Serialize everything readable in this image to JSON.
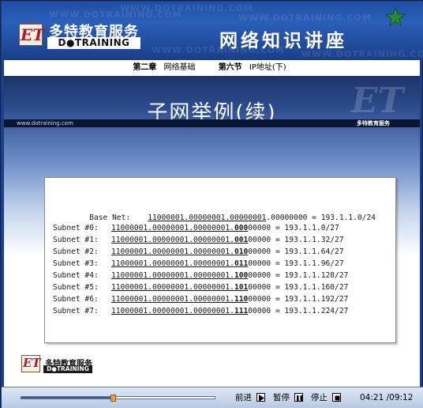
{
  "header": {
    "brand_cn": "多特教育服务",
    "brand_en": "D●TRAINING",
    "logo_letters": "ET",
    "series_title": "网络知识讲座",
    "watermark": "WWW.DOTRAINING.COM"
  },
  "chapter": {
    "chapter_label": "第二章",
    "chapter_name": "网络基础",
    "section_label": "第六节",
    "section_name": "IP地址(下)"
  },
  "slide": {
    "title": "子网举例(续)",
    "url": "www.dotraining.com",
    "brand": "多特教育服务",
    "rows": [
      {
        "label": "Base Net:",
        "net_bits": "11000001.00000001.00000001",
        "subnet_bits": "",
        "host_bits": ".00000000",
        "result": "= 193.1.1.0/24"
      },
      {
        "label": "Subnet #0:",
        "net_bits": "11000001.00000001.00000001.",
        "subnet_bits": "000",
        "host_bits": "00000",
        "result": "= 193.1.1.0/27"
      },
      {
        "label": "Subnet #1:",
        "net_bits": "11000001.00000001.00000001.",
        "subnet_bits": "001",
        "host_bits": "00000",
        "result": "= 193.1.1.32/27"
      },
      {
        "label": "Subnet #2:",
        "net_bits": "11000001.00000001.00000001.",
        "subnet_bits": "010",
        "host_bits": "00000",
        "result": "= 193.1.1.64/27"
      },
      {
        "label": "Subnet #3:",
        "net_bits": "11000001.00000001.00000001.",
        "subnet_bits": "011",
        "host_bits": "00000",
        "result": "= 193.1.1.96/27"
      },
      {
        "label": "Subnet #4:",
        "net_bits": "11000001.00000001.00000001.",
        "subnet_bits": "100",
        "host_bits": "00000",
        "result": "= 193.1.1.128/27"
      },
      {
        "label": "Subnet #5:",
        "net_bits": "11000001.00000001.00000001.",
        "subnet_bits": "101",
        "host_bits": "00000",
        "result": "= 193.1.1.160/27"
      },
      {
        "label": "Subnet #6:",
        "net_bits": "11000001.00000001.00000001.",
        "subnet_bits": "110",
        "host_bits": "00000",
        "result": "= 193.1.1.192/27"
      },
      {
        "label": "Subnet #7:",
        "net_bits": "11000001.00000001.00000001.",
        "subnet_bits": "111",
        "host_bits": "00000",
        "result": "= 193.1.1.224/27"
      }
    ],
    "footer_brand_cn": "多特教育服务",
    "footer_brand_en": "D●TRAINING",
    "footer_logo": "ET"
  },
  "controls": {
    "progress_fraction": 0.475,
    "forward_label": "前进",
    "pause_label": "暂停",
    "stop_label": "停止",
    "time_current": "04:21",
    "time_total": "/09:12"
  },
  "colors": {
    "header_blue": "#1e4fa6",
    "star_green": "#2a8a3a",
    "logo_red": "#b5172b"
  }
}
